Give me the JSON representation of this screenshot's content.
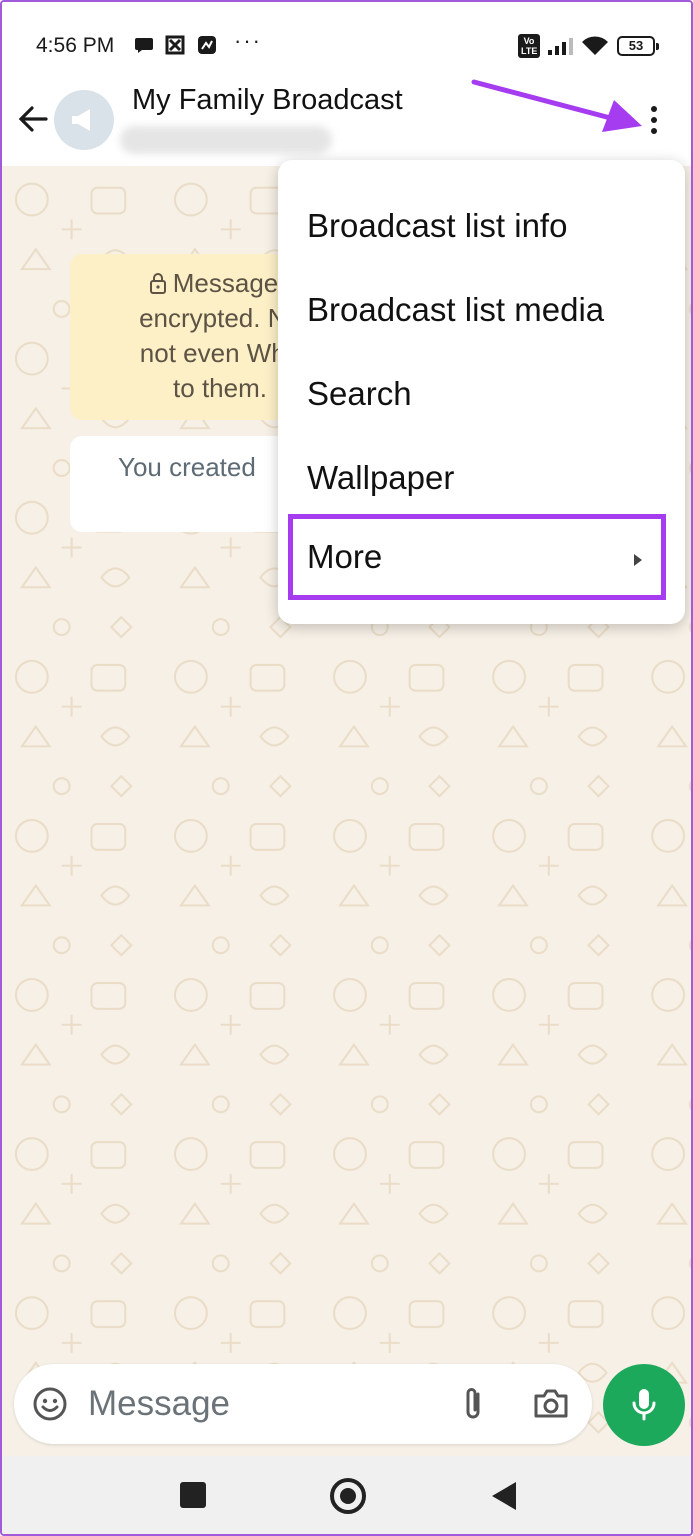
{
  "status_bar": {
    "time": "4:56 PM",
    "notification_icons": [
      "chat-bubble-icon",
      "app-icon",
      "app-icon"
    ],
    "more_dots": "···",
    "volte": "Vo LTE",
    "battery": "53"
  },
  "header": {
    "title": "My Family Broadcast",
    "subtitle_blurred": true
  },
  "chat": {
    "encryption_notice": {
      "line1": "Messages",
      "line2": "encrypted. No",
      "line3": "not even Wha",
      "line4": "to them."
    },
    "created_message": "You created"
  },
  "menu": {
    "items": [
      {
        "label": "Broadcast list info"
      },
      {
        "label": "Broadcast list media"
      },
      {
        "label": "Search"
      },
      {
        "label": "Wallpaper"
      },
      {
        "label": "More",
        "has_submenu": true,
        "highlighted": true
      }
    ]
  },
  "composer": {
    "placeholder": "Message"
  },
  "colors": {
    "accent_green": "#1da95c",
    "highlight_purple": "#a53cf0",
    "wallpaper": "#f6f0e6",
    "notice_bg": "#fdf0c7"
  }
}
